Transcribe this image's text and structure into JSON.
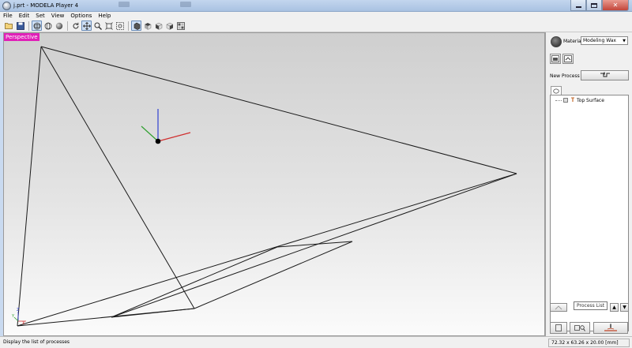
{
  "window": {
    "title": "j.prt - MODELA Player 4",
    "minimize_icon": "minimize-icon",
    "maximize_icon": "maximize-icon",
    "close_glyph": "✕"
  },
  "menu": {
    "items": [
      "File",
      "Edit",
      "Set",
      "View",
      "Options",
      "Help"
    ]
  },
  "toolbar": {
    "icons": [
      "open-folder-icon",
      "save-icon",
      "orbit-view-icon",
      "globe-view-icon",
      "sphere-icon",
      "rotate-icon",
      "pan-icon",
      "zoom-icon",
      "fit-view-icon",
      "zoom-window-icon",
      "view-front-icon",
      "view-top-icon",
      "view-iso-icon",
      "view-side-icon",
      "view-grid-icon"
    ],
    "active": [
      "orbit-view-icon",
      "pan-icon",
      "view-front-icon"
    ]
  },
  "viewport": {
    "label": "Perspective",
    "label_color": "#e020b8",
    "axis_colors": {
      "x": "#d03030",
      "y": "#30a030",
      "z": "#3040d0"
    },
    "corner_axes": {
      "x": "X",
      "y": "Y",
      "z": "Z"
    }
  },
  "panel": {
    "material_label": "Material",
    "material_value": "Modeling Wax",
    "new_process_label": "New Process",
    "process_items": [
      {
        "label": "Top Surface"
      }
    ],
    "process_list_tooltip": "Process List"
  },
  "status": {
    "message": "Display the list of processes",
    "dimensions": "72.32 x 63.26 x 20.00 [mm]"
  }
}
